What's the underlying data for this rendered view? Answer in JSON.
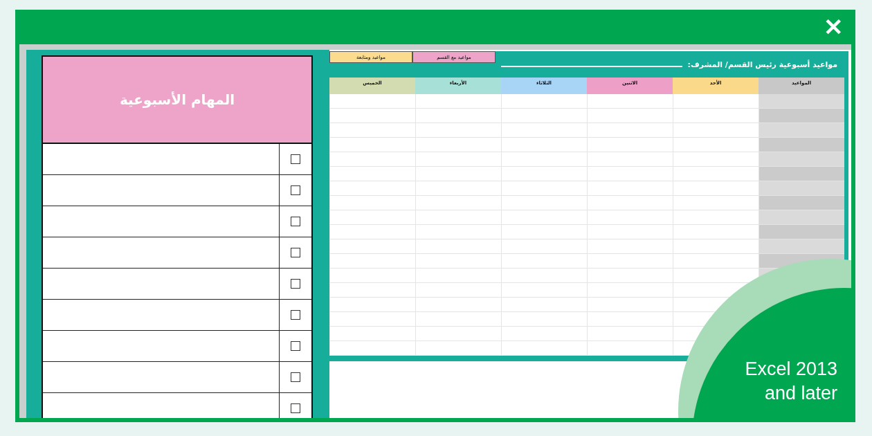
{
  "window": {
    "close": "✕"
  },
  "tasks_panel": {
    "title": "المهام الأسبوعية",
    "tasks": [
      {
        "checked": false
      },
      {
        "checked": false
      },
      {
        "checked": false
      },
      {
        "checked": false
      },
      {
        "checked": false
      },
      {
        "checked": false
      },
      {
        "checked": false
      },
      {
        "checked": false
      },
      {
        "checked": false
      }
    ]
  },
  "schedule": {
    "title": "مواعيد أسبوعية رئيس القسم/ المشرف:",
    "legend": [
      {
        "label": "مواعيد مع القسم",
        "color": "#eea4c8"
      },
      {
        "label": "مواعيد ومتابعة",
        "color": "#fbdc8e"
      }
    ],
    "columns": [
      {
        "label": "المواعيد",
        "color": "#c8c8c8"
      },
      {
        "label": "الأحد",
        "color": "#fbd98a"
      },
      {
        "label": "الاثنين",
        "color": "#ee9fc8"
      },
      {
        "label": "الثلاثاء",
        "color": "#a8d4f5"
      },
      {
        "label": "الأربعاء",
        "color": "#a6e0d6"
      },
      {
        "label": "الخميس",
        "color": "#d3dcb0"
      }
    ]
  },
  "badge": {
    "text": "Excel 2013 and later"
  }
}
